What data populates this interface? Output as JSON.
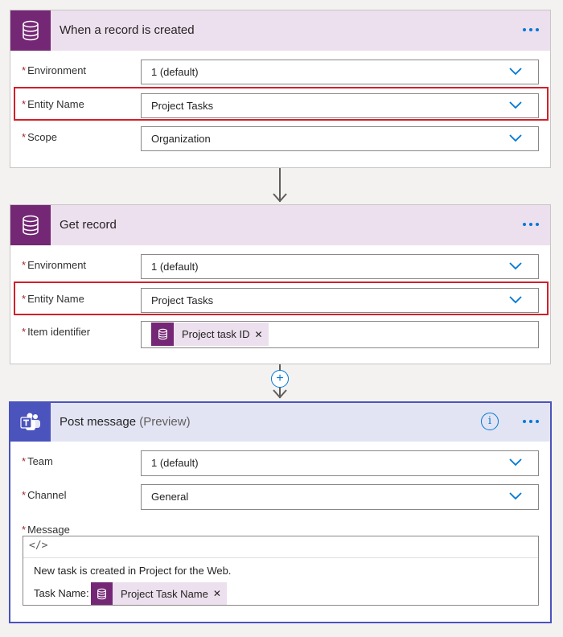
{
  "trigger": {
    "title": "When a record is created",
    "fields": [
      {
        "label": "Environment",
        "value": "1 (default)"
      },
      {
        "label": "Entity Name",
        "value": "Project Tasks"
      },
      {
        "label": "Scope",
        "value": "Organization"
      }
    ]
  },
  "get_record": {
    "title": "Get record",
    "fields": [
      {
        "label": "Environment",
        "value": "1 (default)"
      },
      {
        "label": "Entity Name",
        "value": "Project Tasks"
      },
      {
        "label": "Item identifier",
        "token": "Project task ID"
      }
    ]
  },
  "post_message": {
    "title": "Post message",
    "subtitle": "(Preview)",
    "fields": [
      {
        "label": "Team",
        "value": "1 (default)"
      },
      {
        "label": "Channel",
        "value": "General"
      },
      {
        "label": "Message"
      }
    ],
    "code_icon": "</>",
    "message_line1": "New task is created in Project for the Web.",
    "message_line2_prefix": "Task Name:",
    "message_token": "Project Task Name"
  },
  "required_marker": "*",
  "token_remove": "✕",
  "info_glyph": "i",
  "plus_glyph": "+",
  "colors": {
    "dataverse": "#742774",
    "dataverse_header": "#ecdfee",
    "teams": "#4b53bc",
    "teams_header": "#e2e4f4",
    "accent": "#0078d4",
    "highlight": "#d21f2a"
  }
}
